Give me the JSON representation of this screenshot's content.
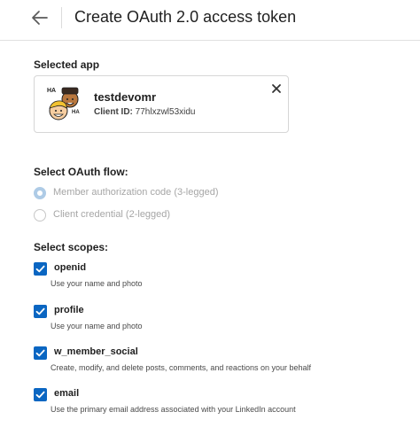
{
  "header": {
    "title": "Create OAuth 2.0 access token",
    "back_icon": "arrow-left-icon"
  },
  "selected_app": {
    "section_label": "Selected app",
    "app_name": "testdevomr",
    "client_id_label": "Client ID:",
    "client_id_value": "77hlxzwl53xidu",
    "close_icon": "close-icon"
  },
  "oauth_flow": {
    "section_label": "Select OAuth flow:",
    "options": [
      {
        "label": "Member authorization code (3-legged)",
        "selected": true,
        "disabled": true
      },
      {
        "label": "Client credential (2-legged)",
        "selected": false,
        "disabled": true
      }
    ]
  },
  "scopes": {
    "section_label": "Select scopes:",
    "items": [
      {
        "name": "openid",
        "description": "Use your name and photo",
        "checked": true
      },
      {
        "name": "profile",
        "description": "Use your name and photo",
        "checked": true
      },
      {
        "name": "w_member_social",
        "description": "Create, modify, and delete posts, comments, and reactions on your behalf",
        "checked": true
      },
      {
        "name": "email",
        "description": "Use the primary email address associated with your LinkedIn account",
        "checked": true
      }
    ]
  },
  "colors": {
    "checkbox": "#0a66c2",
    "radio_selected": "#aecbe6",
    "disabled_text": "#a6a6a6"
  }
}
